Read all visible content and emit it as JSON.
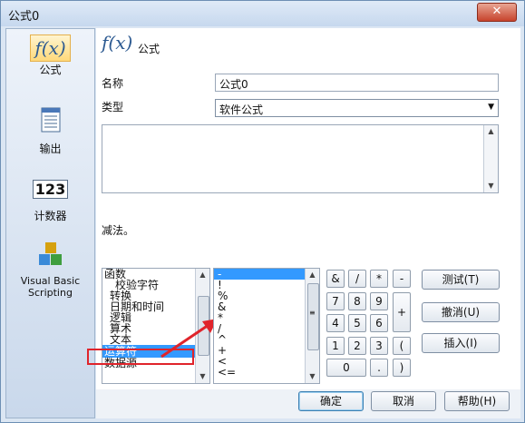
{
  "window": {
    "title": "公式0",
    "close": "✕"
  },
  "sidebar": {
    "items": [
      {
        "label": "公式",
        "icon": "formula-fx-icon",
        "glyph": "f(x)"
      },
      {
        "label": "输出",
        "icon": "output-document-icon"
      },
      {
        "label": "计数器",
        "icon": "counter-123-icon",
        "glyph": "123"
      },
      {
        "label": "Visual Basic Scripting",
        "icon": "vbscript-blocks-icon"
      }
    ]
  },
  "header": {
    "title": "公式",
    "glyph": "f(x)"
  },
  "form": {
    "name_label": "名称",
    "name_value": "公式0",
    "type_label": "类型",
    "type_value": "软件公式",
    "description": "减法。"
  },
  "categories": [
    "函数",
    "校验字符",
    "转换",
    "日期和时间",
    "逻辑",
    "算术",
    "文本",
    "运算符",
    "数据源"
  ],
  "selected_category": "运算符",
  "operators": [
    "-",
    "!",
    "%",
    "&",
    "*",
    "/",
    "^",
    "+",
    "<",
    "<="
  ],
  "selected_operator": "-",
  "keypad": {
    "row1": [
      "&",
      "/",
      "*",
      "-"
    ],
    "row2": [
      "7",
      "8",
      "9"
    ],
    "row3": [
      "4",
      "5",
      "6"
    ],
    "row4": [
      "1",
      "2",
      "3"
    ],
    "row5": [
      "0",
      "."
    ],
    "plus": "+",
    "lparen": "(",
    "rparen": ")"
  },
  "actions": {
    "test": "测试(T)",
    "undo": "撤消(U)",
    "insert": "插入(I)"
  },
  "footer": {
    "ok": "确定",
    "cancel": "取消",
    "help": "帮助(H)"
  },
  "colors": {
    "selection": "#3399ff",
    "highlight_box": "#e0242b",
    "accent": "#2d5a91"
  }
}
